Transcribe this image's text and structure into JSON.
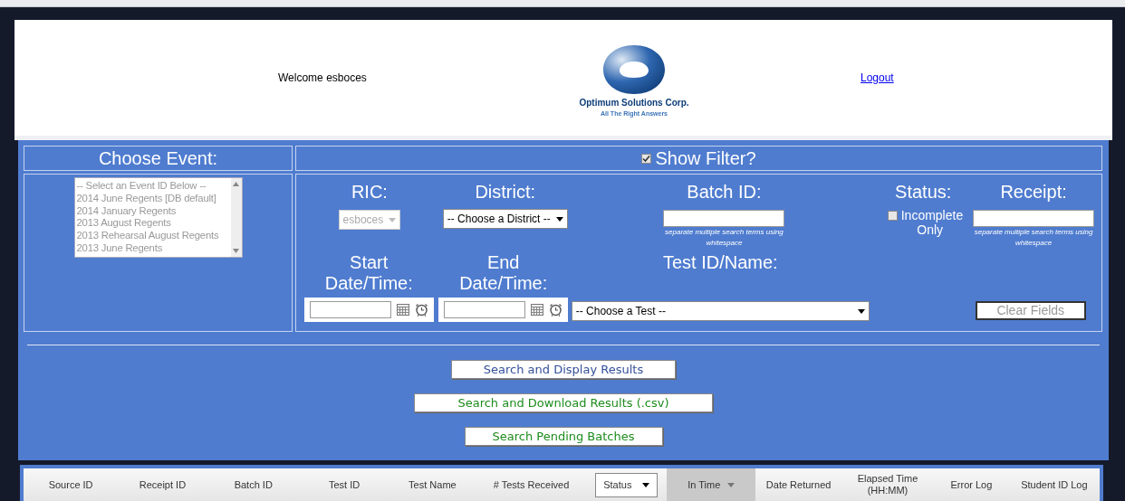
{
  "header": {
    "welcome": "Welcome esboces",
    "logo_name": "Optimum Solutions Corp.",
    "logo_tagline": "All The Right Answers",
    "logout": "Logout"
  },
  "event_panel": {
    "title": "Choose Event:",
    "disabled": true,
    "items": [
      "-- Select an Event ID Below --",
      "2014 June Regents [DB default]",
      "2014 January Regents",
      "2013 August Regents",
      "2013 Rehearsal August Regents",
      "2013 June Regents"
    ]
  },
  "filter_toggle": {
    "label": "Show Filter?",
    "checked": true
  },
  "filters": {
    "ric": {
      "label": "RIC:",
      "value": "esboces",
      "disabled": true
    },
    "district": {
      "label": "District:",
      "value": "-- Choose a District --",
      "disabled": false
    },
    "batch_id": {
      "label": "Batch ID:",
      "hint": "separate multiple search terms using whitespace"
    },
    "status": {
      "label": "Status:",
      "option": "Incomplete Only",
      "checked": false
    },
    "receipt": {
      "label": "Receipt:",
      "hint": "separate multiple search terms using whitespace"
    },
    "start": {
      "label": "Start Date/Time:"
    },
    "end": {
      "label": "End Date/Time:"
    },
    "test": {
      "label": "Test ID/Name:",
      "value": "-- Choose a Test --"
    },
    "clear": "Clear Fields"
  },
  "actions": [
    {
      "label": "Search and Display Results",
      "color": "#34509a"
    },
    {
      "label": "Search and Download Results (.csv)",
      "color": "#1e8c1e"
    },
    {
      "label": "Search Pending Batches",
      "color": "#1e8c1e"
    }
  ],
  "table": {
    "columns": [
      {
        "label": "Source ID",
        "kind": "text",
        "sorted": false
      },
      {
        "label": "Receipt ID",
        "kind": "text",
        "sorted": false
      },
      {
        "label": "Batch ID",
        "kind": "text",
        "sorted": false
      },
      {
        "label": "Test ID",
        "kind": "text",
        "sorted": false
      },
      {
        "label": "Test Name",
        "kind": "text",
        "sorted": false
      },
      {
        "label": "# Tests Received",
        "kind": "text",
        "sorted": false
      },
      {
        "label": "Status",
        "kind": "dropdown",
        "sorted": false
      },
      {
        "label": "In Time",
        "kind": "text",
        "sorted": true
      },
      {
        "label": "Date Returned",
        "kind": "text",
        "sorted": false
      },
      {
        "label": "Elapsed Time (HH:MM)",
        "kind": "text",
        "sorted": false
      },
      {
        "label": "Error Log",
        "kind": "text",
        "sorted": false
      },
      {
        "label": "Student ID Log",
        "kind": "text",
        "sorted": false
      }
    ]
  }
}
